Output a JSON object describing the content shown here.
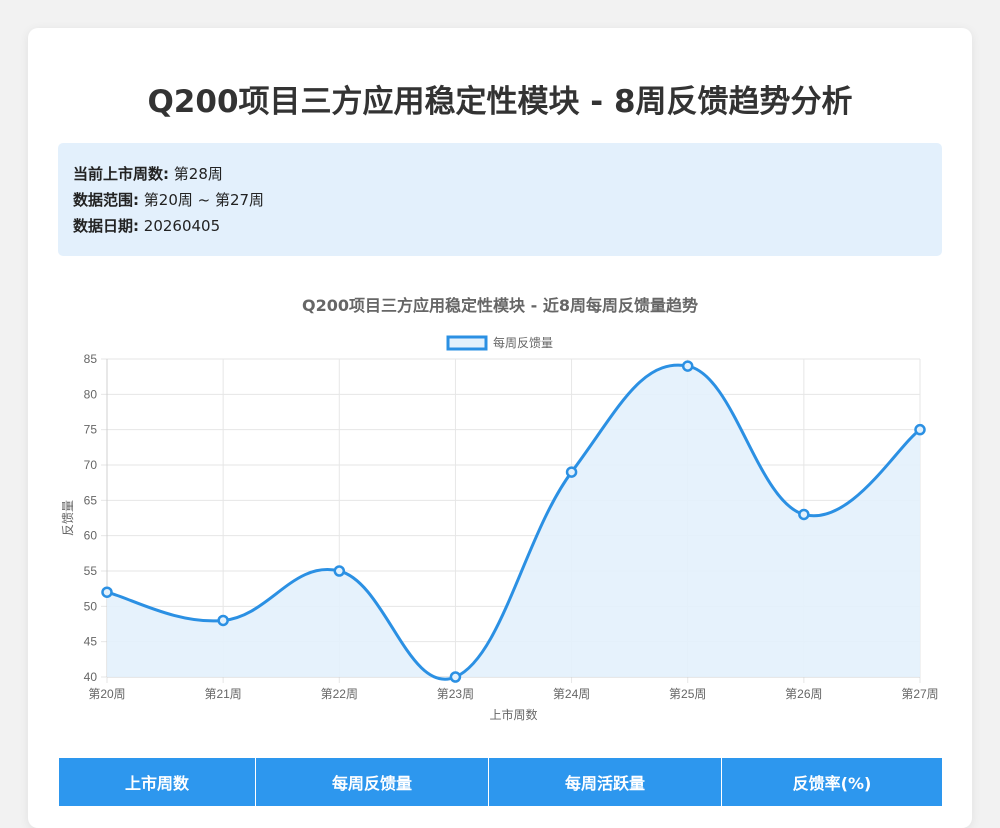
{
  "page": {
    "title": "Q200项目三方应用稳定性模块 - 8周反馈趋势分析"
  },
  "info": {
    "current_week_label": "当前上市周数:",
    "current_week_value": "第28周",
    "range_label": "数据范围:",
    "range_value": "第20周 ~ 第27周",
    "date_label": "数据日期:",
    "date_value": "20260405"
  },
  "colors": {
    "accent": "#2d97ee",
    "line": "#2b90e3",
    "fill": "#e3f1fc",
    "info_bg": "#e3f0fc"
  },
  "chart_data": {
    "type": "line",
    "title": "Q200项目三方应用稳定性模块 - 近8周每周反馈量趋势",
    "categories": [
      "第20周",
      "第21周",
      "第22周",
      "第23周",
      "第24周",
      "第25周",
      "第26周",
      "第27周"
    ],
    "series": [
      {
        "name": "每周反馈量",
        "values": [
          52,
          48,
          55,
          40,
          69,
          84,
          63,
          75
        ]
      }
    ],
    "xlabel": "上市周数",
    "ylabel": "反馈量",
    "ylim": [
      40,
      85
    ],
    "yticks": [
      40,
      45,
      50,
      55,
      60,
      65,
      70,
      75,
      80,
      85
    ],
    "grid": true,
    "legend": "top",
    "smooth": true,
    "filled": true
  },
  "table": {
    "headers": [
      "上市周数",
      "每周反馈量",
      "每周活跃量",
      "反馈率(%)"
    ]
  }
}
